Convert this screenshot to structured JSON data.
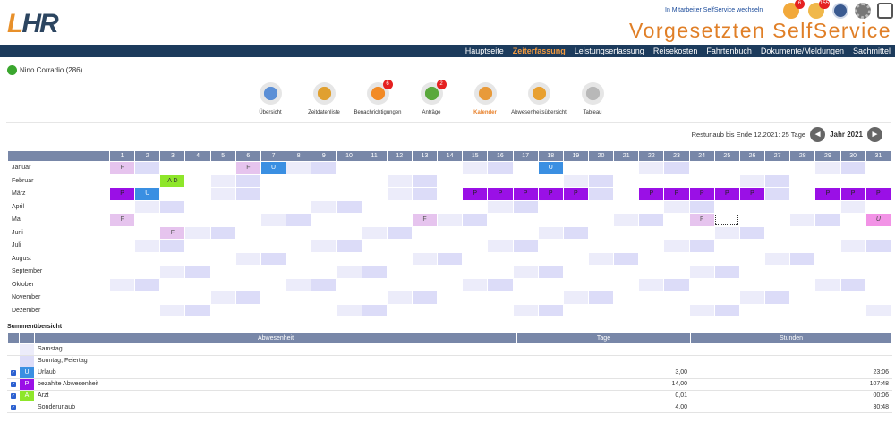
{
  "header": {
    "logo_a": "L",
    "logo_b": "HR",
    "switch_link": "In Mitarbeiter SelfService wechseln",
    "badge_a": "6",
    "badge_b": "155",
    "app_title": "Vorgesetzten SelfService"
  },
  "nav": [
    "Hauptseite",
    "Zeiterfassung",
    "Leistungserfassung",
    "Reisekosten",
    "Fahrtenbuch",
    "Dokumente/Meldungen",
    "Sachmittel"
  ],
  "nav_active": 1,
  "user": {
    "name": "Nino Corradio (286)"
  },
  "toolbar": [
    {
      "label": "Übersicht",
      "icon": "overview-icon",
      "color": "#5b8fd6"
    },
    {
      "label": "Zeitdatenliste",
      "icon": "clock-icon",
      "color": "#e0a030"
    },
    {
      "label": "Benachrichtigungen",
      "icon": "chat-bubble-icon",
      "color": "#f28a25",
      "badge": "6"
    },
    {
      "label": "Anträge",
      "icon": "checklist-icon",
      "color": "#5aa83c",
      "badge": "2"
    },
    {
      "label": "Kalender",
      "icon": "calendar-icon",
      "color": "#e89a3a"
    },
    {
      "label": "Abwesenheitsübersicht",
      "icon": "absence-icon",
      "color": "#e8a030"
    },
    {
      "label": "Tableau",
      "icon": "tableau-icon",
      "color": "#b8b8b8"
    }
  ],
  "toolbar_active": 4,
  "year_bar": {
    "text": "Resturlaub bis Ende 12.2021: 25 Tage",
    "year": "Jahr 2021",
    "prev": "◄",
    "next": "►"
  },
  "calendar": {
    "days": [
      "1",
      "2",
      "3",
      "4",
      "5",
      "6",
      "7",
      "8",
      "9",
      "10",
      "11",
      "12",
      "13",
      "14",
      "15",
      "16",
      "17",
      "18",
      "19",
      "20",
      "21",
      "22",
      "23",
      "24",
      "25",
      "26",
      "27",
      "28",
      "29",
      "30",
      "31"
    ],
    "months": [
      {
        "name": "Januar",
        "len": 31,
        "first": 5,
        "marks": {
          "1": "F",
          "6": "F",
          "7": "U",
          "18": "U"
        }
      },
      {
        "name": "Februar",
        "len": 28,
        "first": 1,
        "marks": {
          "3": "AD"
        }
      },
      {
        "name": "März",
        "len": 31,
        "first": 1,
        "marks": {
          "1": "P",
          "2": "U",
          "15": "P",
          "16": "P",
          "17": "P",
          "18": "P",
          "19": "P",
          "22": "P",
          "23": "P",
          "24": "P",
          "25": "P",
          "26": "P",
          "29": "P",
          "30": "P",
          "31": "P"
        }
      },
      {
        "name": "April",
        "len": 30,
        "first": 4,
        "marks": {}
      },
      {
        "name": "Mai",
        "len": 31,
        "first": 6,
        "marks": {
          "1": "F",
          "13": "F",
          "24": "F",
          "31": "Ux"
        },
        "selected": 25
      },
      {
        "name": "Juni",
        "len": 30,
        "first": 2,
        "marks": {
          "3": "F"
        }
      },
      {
        "name": "Juli",
        "len": 31,
        "first": 4,
        "marks": {}
      },
      {
        "name": "August",
        "len": 31,
        "first": 0,
        "marks": {}
      },
      {
        "name": "September",
        "len": 30,
        "first": 3,
        "marks": {}
      },
      {
        "name": "Oktober",
        "len": 31,
        "first": 5,
        "marks": {}
      },
      {
        "name": "November",
        "len": 30,
        "first": 1,
        "marks": {}
      },
      {
        "name": "Dezember",
        "len": 31,
        "first": 3,
        "marks": {}
      }
    ],
    "labels": {
      "F": "F",
      "U": "U",
      "P": "P",
      "AD": "A D",
      "Ux": "U"
    }
  },
  "summary": {
    "title": "Summenübersicht",
    "headers": [
      "Abwesenheit",
      "Tage",
      "Stunden"
    ],
    "rows": [
      {
        "label": "Samstag",
        "check": false,
        "swatch": "#ececfa",
        "code": "",
        "tage": "",
        "stunden": ""
      },
      {
        "label": "Sonntag, Feiertag",
        "check": false,
        "swatch": "#dcdcf8",
        "code": "",
        "tage": "",
        "stunden": ""
      },
      {
        "label": "Urlaub",
        "check": true,
        "swatch": "#3a8fe2",
        "code": "U",
        "tage": "3,00",
        "stunden": "23:06"
      },
      {
        "label": "bezahlte Abwesenheit",
        "check": true,
        "swatch": "#9a10e6",
        "code": "P",
        "tage": "14,00",
        "stunden": "107:48"
      },
      {
        "label": "Arzt",
        "check": true,
        "swatch": "#8ee62a",
        "code": "A",
        "tage": "0,01",
        "stunden": "00:06"
      },
      {
        "label": "Sonderurlaub",
        "check": true,
        "swatch": "#ffffff",
        "code": "",
        "tage": "4,00",
        "stunden": "30:48"
      }
    ]
  }
}
